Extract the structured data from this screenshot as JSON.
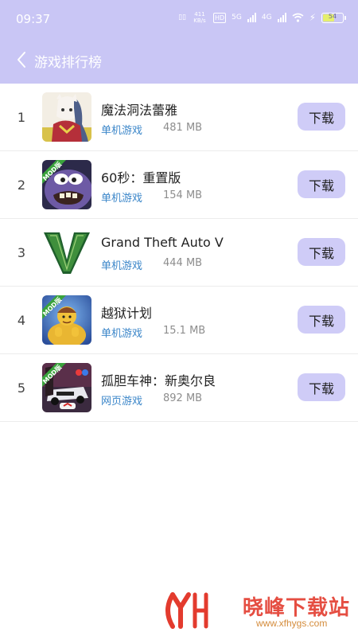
{
  "status_bar": {
    "time": "09:37",
    "net_speed": "411 KB/s",
    "hd": "HD",
    "network_5g": "5G",
    "network_4g": "4G",
    "battery": "54"
  },
  "header": {
    "title": "游戏排行榜",
    "back_icon": "chevron-left-icon",
    "bg_color": "#c9c6f5"
  },
  "games": [
    {
      "rank": "1",
      "name": "魔法洞法蕾雅",
      "category": "单机游戏",
      "size": "481 MB",
      "download_label": "下载"
    },
    {
      "rank": "2",
      "name": "60秒：重置版",
      "category": "单机游戏",
      "size": "154 MB",
      "download_label": "下载",
      "badge": "MOD版"
    },
    {
      "rank": "3",
      "name": "Grand Theft Auto V",
      "category": "单机游戏",
      "size": "444 MB",
      "download_label": "下载"
    },
    {
      "rank": "4",
      "name": "越狱计划",
      "category": "单机游戏",
      "size": "15.1 MB",
      "download_label": "下载",
      "badge": "MOD版"
    },
    {
      "rank": "5",
      "name": "孤胆车神：新奥尔良",
      "category": "网页游戏",
      "size": "892 MB",
      "download_label": "下载",
      "badge": "MOD版"
    }
  ],
  "watermark": {
    "text": "晓峰下载站",
    "url": "www.xfhygs.com"
  },
  "colors": {
    "accent": "#c9c6f5",
    "button": "#cfccf7",
    "category": "#3b86c9"
  }
}
